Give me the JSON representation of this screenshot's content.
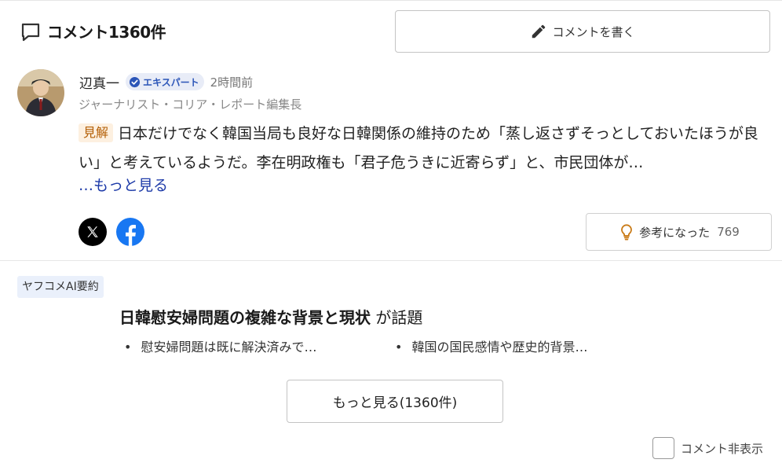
{
  "header": {
    "title": "コメント1360件",
    "write_button": "コメントを書く"
  },
  "comment": {
    "author_name": "辺真一",
    "badge": "エキスパート",
    "time": "2時間前",
    "author_title": "ジャーナリスト・コリア・レポート編集長",
    "tag": "見解",
    "text": "日本だけでなく韓国当局も良好な日韓関係の維持のため「蒸し返さずそっとしておいたほうが良い」と考えているようだ。李在明政権も「君子危うきに近寄らず」と、市民団体が…",
    "more_link": "…もっと見る",
    "helpful_label": "参考になった",
    "helpful_count": "769"
  },
  "ai_summary": {
    "label": "ヤフコメAI要約",
    "title": "日韓慰安婦問題の複雑な背景と現状",
    "title_suffix": " が話題",
    "bullets": [
      "慰安婦問題は既に解決済みで…",
      "韓国の国民感情や歴史的背景…"
    ]
  },
  "footer": {
    "more_button": "もっと見る(1360件)",
    "hide_label": "コメント非表示"
  },
  "icons": [
    "comment-icon",
    "pencil-icon",
    "verified-icon",
    "x-logo-icon",
    "facebook-icon",
    "lightbulb-icon"
  ],
  "colors": {
    "link": "#1d3aa8",
    "badge": "#2b55b8",
    "tag_bg": "#fdf0e0",
    "tag_text": "#b45f06",
    "bulb": "#c97a16"
  }
}
